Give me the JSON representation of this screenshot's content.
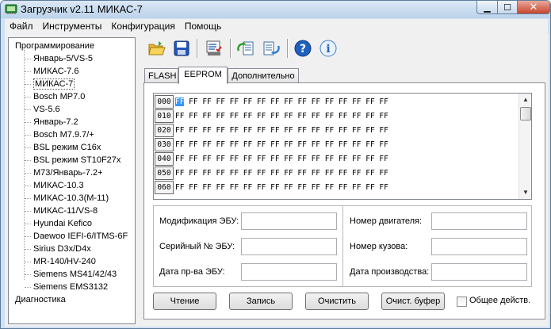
{
  "window": {
    "title": "Загрузчик v2.11 МИКАС-7"
  },
  "menu": [
    "Файл",
    "Инструменты",
    "Конфигурация",
    "Помощь"
  ],
  "tree": {
    "root": "Программирование",
    "items": [
      "Январь-5/VS-5",
      "МИКАС-7.6",
      "МИКАС-7",
      "Bosch MP7.0",
      "VS-5.6",
      "Январь-7.2",
      "Bosch M7.9.7/+",
      "BSL режим C16x",
      "BSL режим ST10F27x",
      "M73/Январь-7.2+",
      "МИКАС-10.3",
      "МИКАС-10.3(M-11)",
      "МИКАС-11/VS-8",
      "Hyundai Kefico",
      "Daewoo IEFI-6/ITMS-6F",
      "Sirius D3x/D4x",
      "MR-140/HV-240",
      "Siemens MS41/42/43",
      "Siemens EMS3132"
    ],
    "selected_index": 2,
    "last": "Диагностика"
  },
  "toolbar": [
    "open-folder-icon",
    "save-icon",
    "settings-checklist-icon",
    "read-ecu-icon",
    "write-ecu-icon",
    "help-icon",
    "info-icon"
  ],
  "tabs": [
    {
      "label": "FLASH"
    },
    {
      "label": "EEPROM",
      "active": true
    },
    {
      "label": "Дополнительно"
    }
  ],
  "hex": {
    "rows": [
      {
        "addr": "000",
        "bytes": "FF FF FF FF FF FF FF FF FF FF FF FF FF FF FF FF"
      },
      {
        "addr": "010",
        "bytes": "FF FF FF FF FF FF FF FF FF FF FF FF FF FF FF FF"
      },
      {
        "addr": "020",
        "bytes": "FF FF FF FF FF FF FF FF FF FF FF FF FF FF FF FF"
      },
      {
        "addr": "030",
        "bytes": "FF FF FF FF FF FF FF FF FF FF FF FF FF FF FF FF"
      },
      {
        "addr": "040",
        "bytes": "FF FF FF FF FF FF FF FF FF FF FF FF FF FF FF FF"
      },
      {
        "addr": "050",
        "bytes": "FF FF FF FF FF FF FF FF FF FF FF FF FF FF FF FF"
      },
      {
        "addr": "060",
        "bytes": "FF FF FF FF FF FF FF FF FF FF FF FF FF FF FF FF"
      }
    ],
    "cursor_byte": "FF"
  },
  "info": {
    "left": [
      {
        "label": "Модификация ЭБУ:",
        "value": ""
      },
      {
        "label": "Серийный № ЭБУ:",
        "value": ""
      },
      {
        "label": "Дата пр-ва ЭБУ:",
        "value": ""
      }
    ],
    "right": [
      {
        "label": "Номер двигателя:",
        "value": ""
      },
      {
        "label": "Номер кузова:",
        "value": ""
      },
      {
        "label": "Дата производства:",
        "value": ""
      }
    ]
  },
  "buttons": {
    "read": "Чтение",
    "write": "Запись",
    "clear": "Очистить",
    "clear_buffer": "Очист. буфер"
  },
  "checkbox": {
    "label": "Общее действ.",
    "checked": false
  },
  "colors": {
    "titlebar": "#c4d9ef",
    "selection": "#3399ff",
    "close": "#c7452e"
  }
}
